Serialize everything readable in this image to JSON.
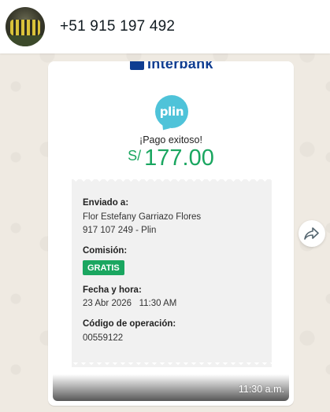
{
  "chat": {
    "contact_name": "+51 915 197 492"
  },
  "receipt": {
    "bank_name": "Interbank",
    "app_logo": "plin",
    "success_message": "¡Pago exitoso!",
    "currency": "S/",
    "amount": "177.00",
    "sent_to_label": "Enviado a:",
    "recipient_name": "Flor Estefany Garriazo Flores",
    "recipient_phone": "917 107 249 - Plin",
    "fee_label": "Comisión:",
    "fee_value": "GRATIS",
    "datetime_label": "Fecha y hora:",
    "datetime_value": "23 Abr 2026   11:30 AM",
    "operation_label": "Código de operación:",
    "operation_code": "00559122"
  },
  "message": {
    "timestamp": "11:30 a.m."
  },
  "icons": {
    "forward": "forward-icon"
  },
  "colors": {
    "accent_green": "#1aa660",
    "plin_blue": "#4fc3d9",
    "bank_blue": "#0f3d91",
    "chat_bg": "#efeae2"
  }
}
